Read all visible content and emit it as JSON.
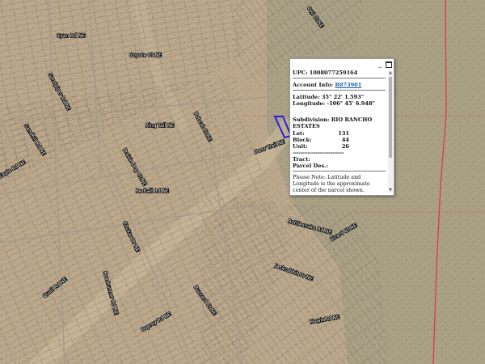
{
  "map": {
    "parcel_outline_color": "#2a1ee0",
    "boundary_line_color": "#e03a3a",
    "street_labels": [
      "Cyan Rd NE",
      "Coyote Ct NE",
      "Sandpiper Rd NE",
      "Ring Tail NE",
      "Bobcat Ct NE",
      "Sandhill Rd NE",
      "Eagle Rd NE",
      "Prairie Dog Ct NE",
      "Redtail Rd NE",
      "Chukar Dr NE",
      "Quail Rd NE",
      "Roadrunner Rd NE",
      "Osprey Rd NE",
      "Buzzard Ct NE",
      "Deer Trail NE",
      "Rattlesnake Rd NE",
      "Lizard Ct NE",
      "Jackrabbit Dr NE",
      "Hawk Rd NE",
      "Owl Ct NE"
    ]
  },
  "popup": {
    "upc_label": "UPC:",
    "upc_value": "1008077259164",
    "account_label": "Account Info:",
    "account_value": "R073901",
    "latitude_label": "Latitude:",
    "latitude_value": "35° 22' 1.593\"",
    "longitude_label": "Longitude:",
    "longitude_value": "-106° 45' 6.948\"",
    "subdivision_label": "Subdivision:",
    "subdivision_value": "RIO RANCHO ESTATES",
    "lot_label": "Lot:",
    "lot_value": "131",
    "block_label": "Block:",
    "block_value": "44",
    "unit_label": "Unit:",
    "unit_value": "26",
    "dashes": "---------------------------",
    "tract_label": "Tract:",
    "parcel_des_label": "Parcel Des.:",
    "note": "Please Note: Latitude and Longitude is the approximate center of the parcel shown.",
    "minimize_icon": "_",
    "maximize_icon": "restore"
  }
}
